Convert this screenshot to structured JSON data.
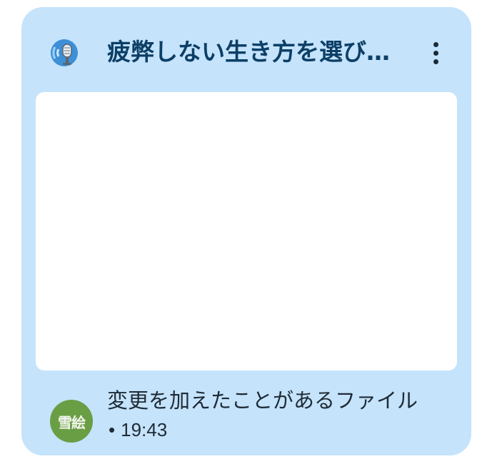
{
  "header": {
    "title": "疲弊しない生き方を選び…",
    "app_icon": "podcast-microphone-icon",
    "more_icon": "more-vert-icon"
  },
  "footer": {
    "avatar_text": "雪絵",
    "subtitle": "変更を加えたことがあるファイル",
    "bullet": "•",
    "time": "19:43"
  },
  "colors": {
    "card_background": "#c5e3fb",
    "title_color": "#0c3f66",
    "avatar_background": "#6a9e44"
  }
}
